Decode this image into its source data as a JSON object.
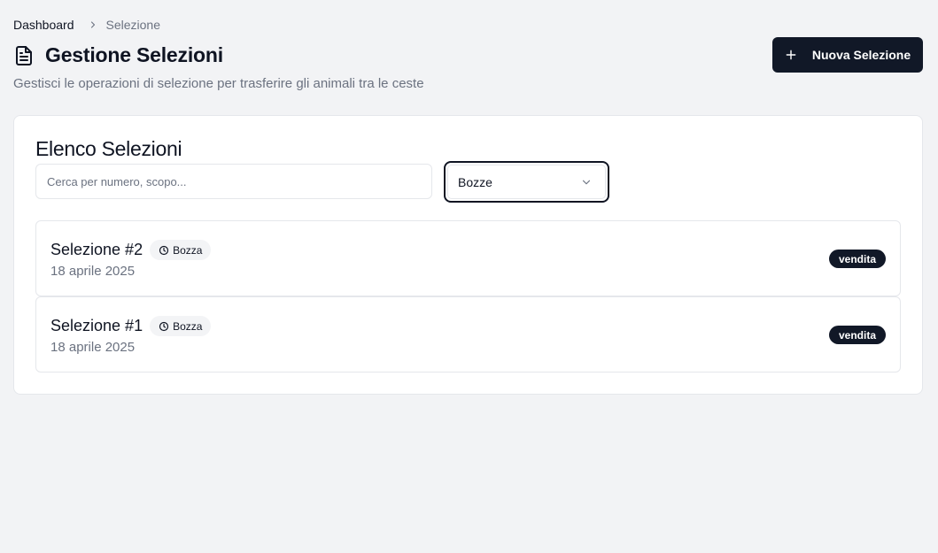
{
  "breadcrumb": {
    "home": "Dashboard",
    "current": "Selezione"
  },
  "header": {
    "title": "Gestione Selezioni",
    "subtitle": "Gestisci le operazioni di selezione per trasferire gli animali tra le ceste",
    "title_icon": "file-text-icon"
  },
  "actions": {
    "new_label": "Nuova Selezione",
    "new_icon": "plus-icon"
  },
  "list": {
    "title": "Elenco Selezioni",
    "search_placeholder": "Cerca per numero, scopo...",
    "search_value": "",
    "filter_value": "Bozze",
    "items": [
      {
        "name": "Selezione #2",
        "status": "Bozza",
        "date": "18 aprile 2025",
        "type": "vendita"
      },
      {
        "name": "Selezione #1",
        "status": "Bozza",
        "date": "18 aprile 2025",
        "type": "vendita"
      }
    ]
  },
  "colors": {
    "background": "#f2f3f5",
    "primary": "#111827",
    "muted_text": "#6b7280",
    "border": "#e5e7eb"
  }
}
